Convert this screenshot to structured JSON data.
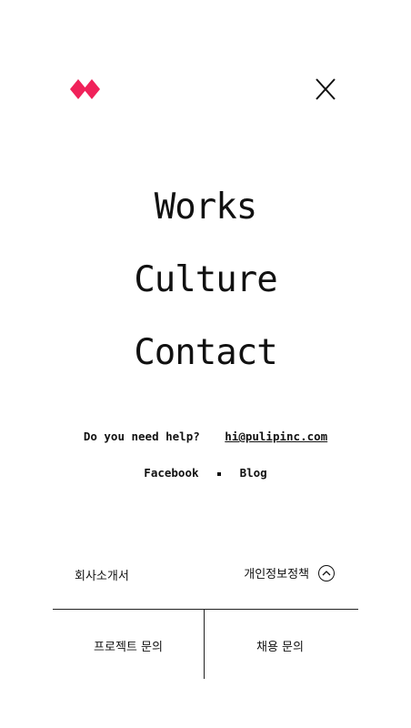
{
  "header": {
    "logo_icon": "diamond-logo-icon",
    "logo_color": "#f0225a",
    "close_icon": "close-icon"
  },
  "nav": {
    "items": [
      {
        "label": "Works"
      },
      {
        "label": "Culture"
      },
      {
        "label": "Contact"
      }
    ]
  },
  "help": {
    "question": "Do you need help?",
    "email": "hi@pulipinc.com"
  },
  "social": {
    "facebook": "Facebook",
    "blog": "Blog"
  },
  "footer": {
    "company_intro": "회사소개서",
    "privacy_policy": "개인정보정책",
    "project_inquiry": "프로젝트 문의",
    "recruit_inquiry": "채용 문의",
    "privacy_toggle_icon": "chevron-up-icon"
  }
}
